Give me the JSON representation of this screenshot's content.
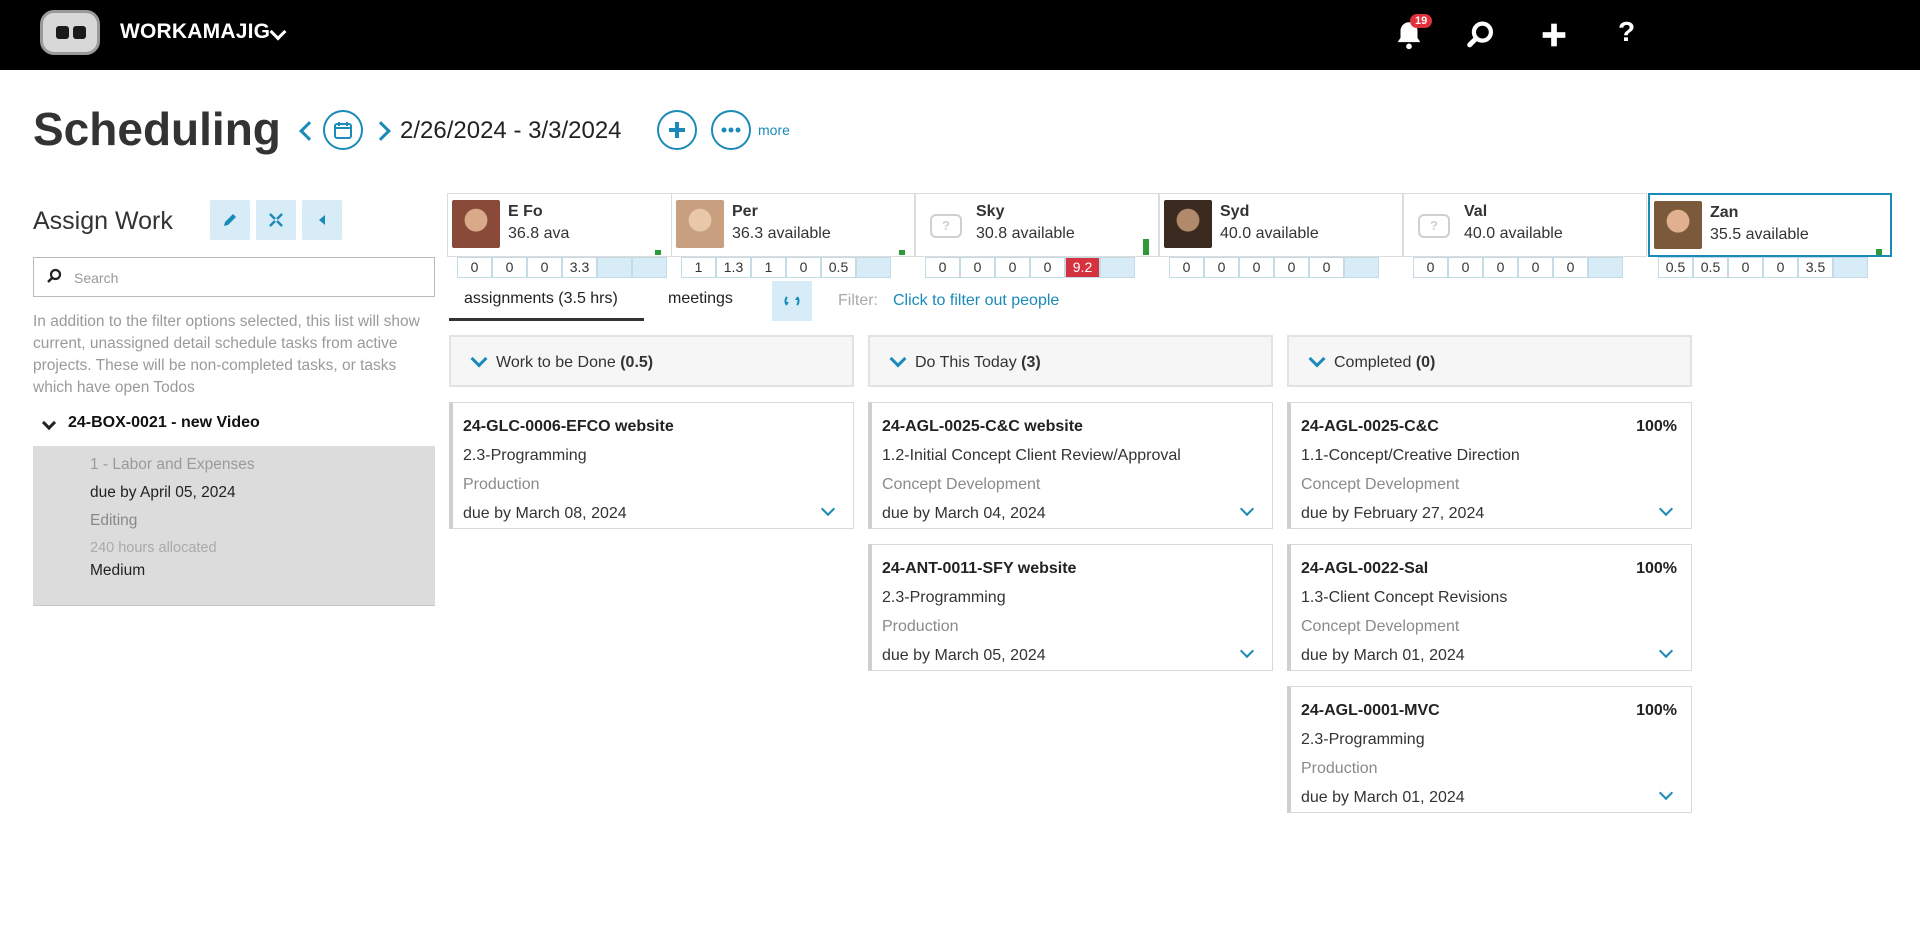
{
  "topbar": {
    "brand": "WORKAMAJIG",
    "notification_count": "19",
    "help_label": "?"
  },
  "header": {
    "title": "Scheduling",
    "date_range": "2/26/2024 - 3/3/2024",
    "more_label": "more"
  },
  "left_panel": {
    "title": "Assign Work",
    "search_placeholder": "Search",
    "info_text": "In addition to the filter options selected, this list will show current, unassigned detail schedule tasks from active projects. These will be non-completed tasks, or tasks which have open Todos",
    "project": {
      "title": "24-BOX-0021 - new Video",
      "task": "1 - Labor and Expenses",
      "due": "due by April 05, 2024",
      "phase": "Editing",
      "hours": "240 hours allocated",
      "priority": "Medium"
    }
  },
  "people": [
    {
      "name": "E Fo",
      "available": "36.8 ava",
      "days": [
        "0",
        "0",
        "0",
        "3.3",
        "",
        ""
      ],
      "hot": -1,
      "avatar": "photo"
    },
    {
      "name": "Per",
      "available": "36.3 available",
      "days": [
        "1",
        "1.3",
        "1",
        "0",
        "0.5",
        ""
      ],
      "hot": -1,
      "avatar": "photo"
    },
    {
      "name": "Sky",
      "available": "30.8 available",
      "days": [
        "0",
        "0",
        "0",
        "0",
        "9.2",
        ""
      ],
      "hot": 4,
      "avatar": "placeholder"
    },
    {
      "name": "Syd",
      "available": "40.0 available",
      "days": [
        "0",
        "0",
        "0",
        "0",
        "0",
        ""
      ],
      "hot": -1,
      "avatar": "photo"
    },
    {
      "name": "Val",
      "available": "40.0 available",
      "days": [
        "0",
        "0",
        "0",
        "0",
        "0",
        ""
      ],
      "hot": -1,
      "avatar": "placeholder"
    },
    {
      "name": "Zan",
      "available": "35.5 available",
      "days": [
        "0.5",
        "0.5",
        "0",
        "0",
        "3.5",
        ""
      ],
      "hot": -1,
      "avatar": "photo"
    }
  ],
  "tabs": {
    "assignments": "assignments (3.5 hrs)",
    "meetings": "meetings"
  },
  "filter": {
    "label": "Filter:",
    "link": "Click to filter out people"
  },
  "columns": [
    {
      "title": "Work to be Done",
      "count": "(0.5)",
      "cards": [
        {
          "title": "24-GLC-0006-EFCO website",
          "pct": "",
          "task": "2.3-Programming",
          "phase": "Production",
          "due": "due by March 08, 2024"
        }
      ]
    },
    {
      "title": "Do This Today",
      "count": "(3)",
      "cards": [
        {
          "title": "24-AGL-0025-C&C website",
          "pct": "",
          "task": "1.2-Initial Concept Client Review/Approval",
          "phase": "Concept Development",
          "due": "due by March 04, 2024"
        },
        {
          "title": "24-ANT-0011-SFY website",
          "pct": "",
          "task": "2.3-Programming",
          "phase": "Production",
          "due": "due by March 05, 2024"
        }
      ]
    },
    {
      "title": "Completed",
      "count": "(0)",
      "cards": [
        {
          "title": "24-AGL-0025-C&C",
          "pct": "100%",
          "task": "1.1-Concept/Creative Direction",
          "phase": "Concept Development",
          "due": "due by February 27, 2024"
        },
        {
          "title": "24-AGL-0022-Sal",
          "pct": "100%",
          "task": "1.3-Client Concept Revisions",
          "phase": "Concept Development",
          "due": "due by March 01, 2024"
        },
        {
          "title": "24-AGL-0001-MVC",
          "pct": "100%",
          "task": "2.3-Programming",
          "phase": "Production",
          "due": "due by March 01, 2024"
        }
      ]
    }
  ],
  "colors": {
    "accent": "#1a8ab8",
    "accent_light": "#d7ecf6",
    "overbooked": "#d3323e",
    "topbar": "#000000"
  }
}
